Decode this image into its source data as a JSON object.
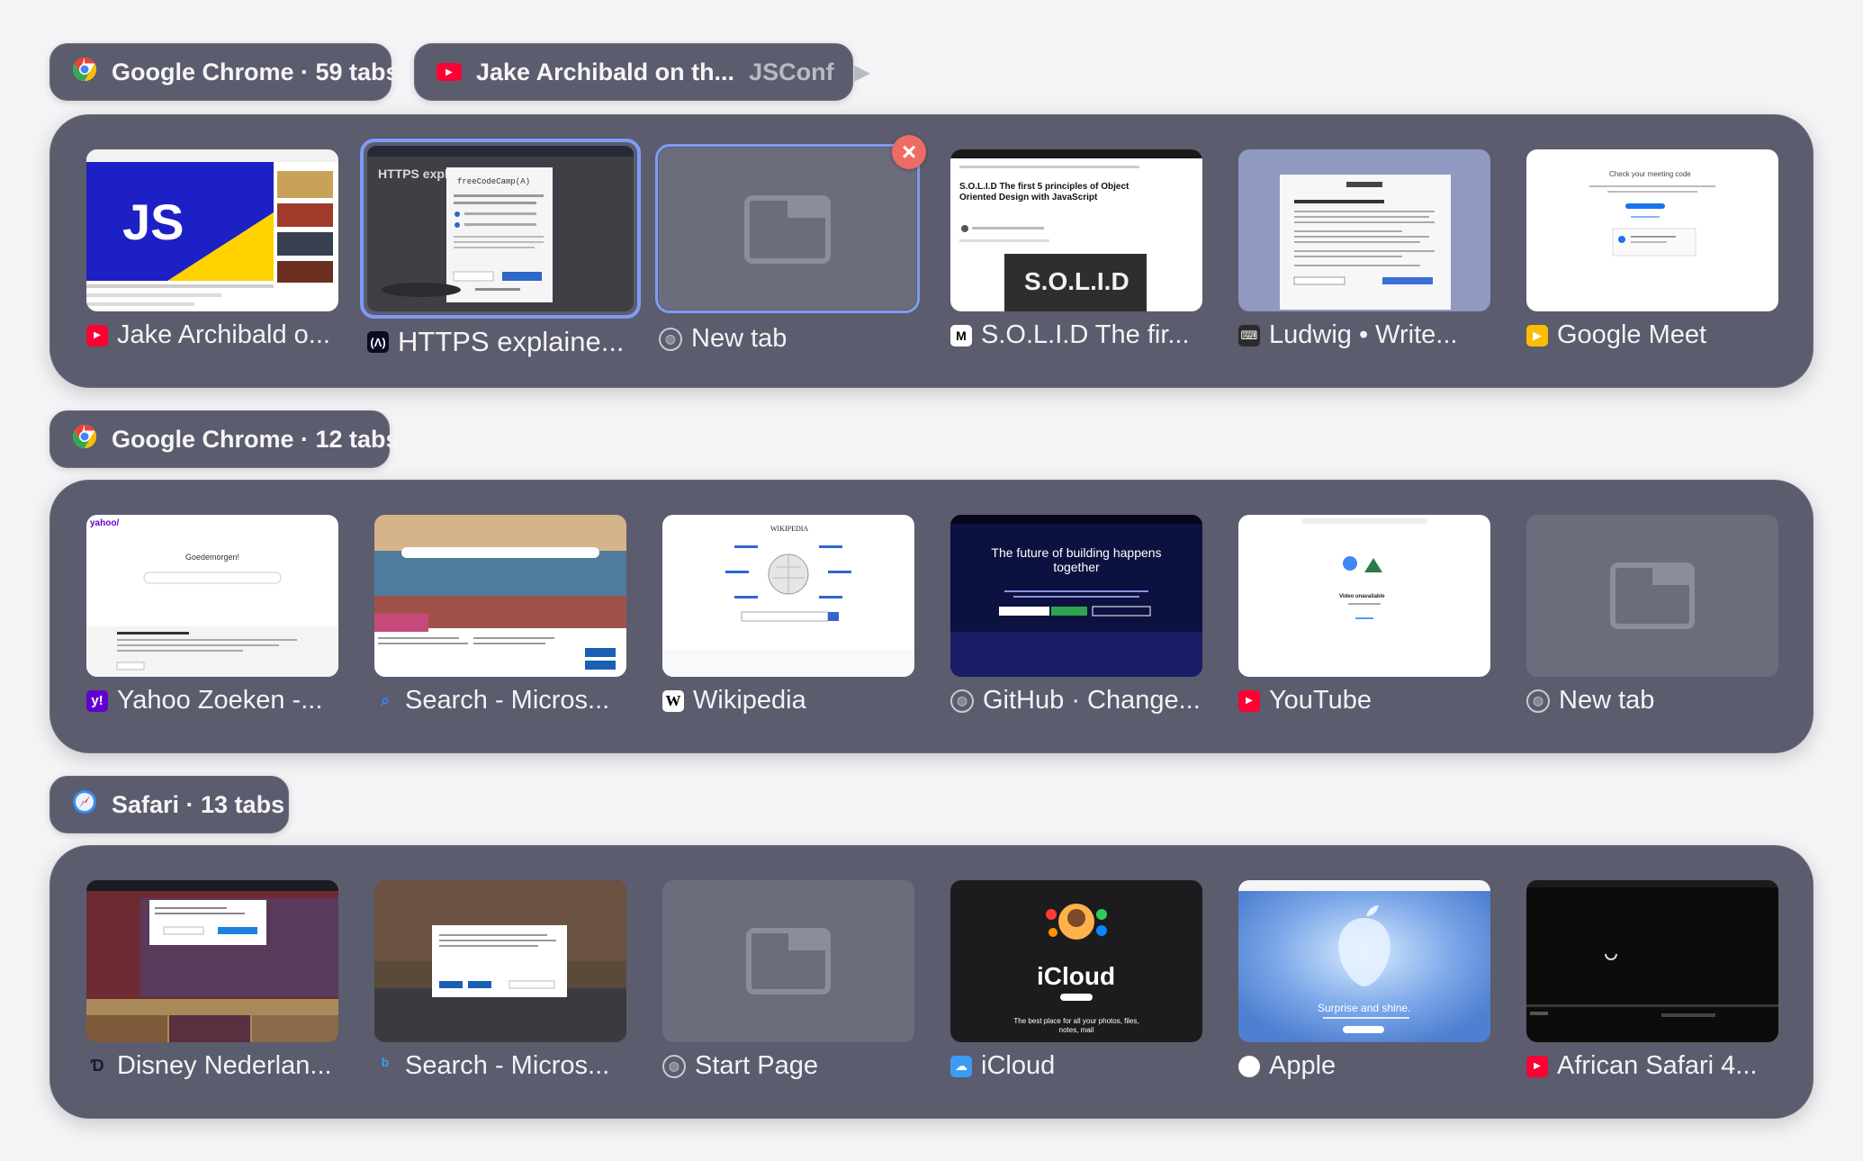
{
  "windows": [
    {
      "app": "Google Chrome",
      "title": "Google Chrome · 59 tabs",
      "media_pill": {
        "title": "Jake Archibald on th...",
        "source": "JSConf"
      },
      "tabs": [
        {
          "label": "Jake Archibald o...",
          "favicon": "youtube-icon"
        },
        {
          "label": "HTTPS explaine...",
          "favicon": "freecodecamp-icon"
        },
        {
          "label": "New tab",
          "favicon": "globe-icon"
        },
        {
          "label": "S.O.L.I.D The fir...",
          "favicon": "medium-icon"
        },
        {
          "label": "Ludwig • Write...",
          "favicon": "typewriter-icon"
        },
        {
          "label": "Google Meet",
          "favicon": "google-meet-icon"
        }
      ]
    },
    {
      "app": "Google Chrome",
      "title": "Google Chrome · 12 tabs",
      "tabs": [
        {
          "label": "Yahoo Zoeken -...",
          "favicon": "yahoo-icon"
        },
        {
          "label": "Search - Micros...",
          "favicon": "search-icon"
        },
        {
          "label": "Wikipedia",
          "favicon": "wikipedia-icon"
        },
        {
          "label": "GitHub · Change...",
          "favicon": "globe-icon"
        },
        {
          "label": "YouTube",
          "favicon": "youtube-icon"
        },
        {
          "label": "New tab",
          "favicon": "globe-icon"
        }
      ]
    },
    {
      "app": "Safari",
      "title": "Safari · 13 tabs",
      "tabs": [
        {
          "label": "Disney Nederlan...",
          "favicon": "disney-icon"
        },
        {
          "label": "Search - Micros...",
          "favicon": "bing-icon"
        },
        {
          "label": "Start Page",
          "favicon": "globe-icon"
        },
        {
          "label": "iCloud",
          "favicon": "icloud-icon"
        },
        {
          "label": "Apple",
          "favicon": "apple-icon"
        },
        {
          "label": "African Safari 4...",
          "favicon": "youtube-icon"
        }
      ]
    }
  ],
  "thumbnail_text": {
    "js": "JS",
    "https_heading": "HTTPS expl",
    "https_dialog": "freeCodeCamp(A)",
    "solid_title": "S.O.L.I.D The first 5 principles of Object Oriented Design with JavaScript",
    "solid_banner": "S.O.L.I.D",
    "yahoo_greeting": "Goedemorgen!",
    "yahoo_logo": "yahoo/",
    "wikipedia_title": "WIKIPEDIA",
    "github_headline": "The future of building happens together",
    "meet_heading": "Check your meeting code",
    "youtube_video_state": "Video unavailable",
    "icloud_title": "iCloud",
    "icloud_tagline": "The best place for all your photos, files, notes, mail",
    "apple_tagline": "Surprise and shine."
  },
  "colors": {
    "group_bg": "#5b5c6d",
    "selected_border": "#7f9bf2",
    "close_button": "#ee6b63"
  }
}
